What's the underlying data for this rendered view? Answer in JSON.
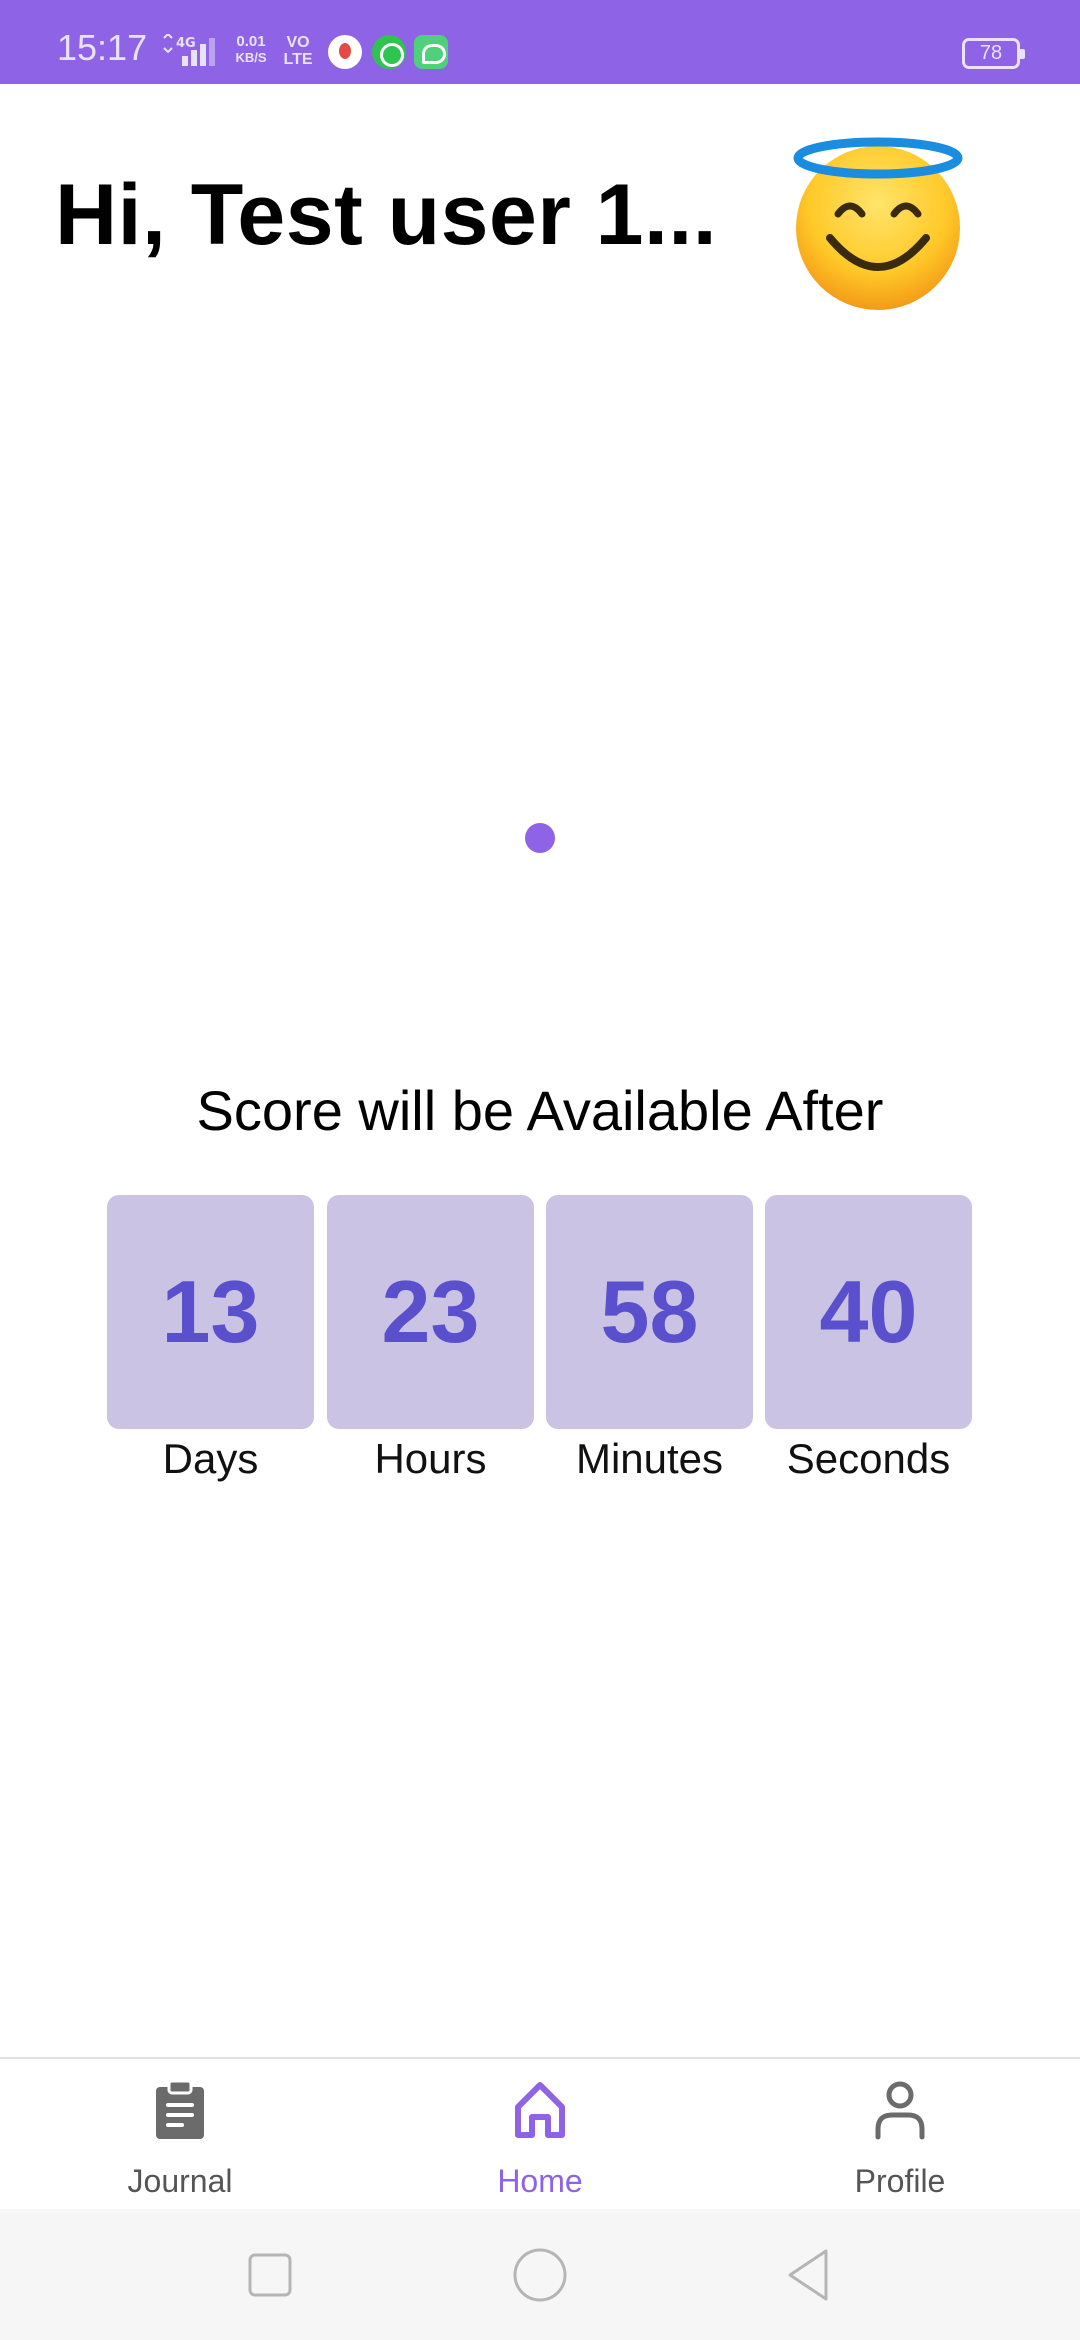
{
  "status_bar": {
    "time": "15:17",
    "network_type": "4G",
    "data_speed_value": "0.01",
    "data_speed_unit": "KB/S",
    "volte_line1": "VO",
    "volte_line2": "LTE",
    "battery": "78",
    "background_color": "#8e63e6"
  },
  "header": {
    "greeting": "Hi, Test user 1...",
    "avatar_icon": "smiling-face-with-halo"
  },
  "score": {
    "title": "Score will be Available After",
    "countdown": [
      {
        "value": "13",
        "label": "Days"
      },
      {
        "value": "23",
        "label": "Hours"
      },
      {
        "value": "58",
        "label": "Minutes"
      },
      {
        "value": "40",
        "label": "Seconds"
      }
    ],
    "box_color": "#cbc3e3",
    "value_color": "#5a4fcc"
  },
  "bottom_nav": {
    "items": [
      {
        "label": "Journal",
        "icon": "clipboard-icon",
        "active": false
      },
      {
        "label": "Home",
        "icon": "home-icon",
        "active": true
      },
      {
        "label": "Profile",
        "icon": "user-icon",
        "active": false
      }
    ],
    "active_color": "#8e63e6",
    "inactive_color": "#555555"
  },
  "system_nav": {
    "buttons": [
      "recent-apps",
      "home",
      "back"
    ]
  }
}
